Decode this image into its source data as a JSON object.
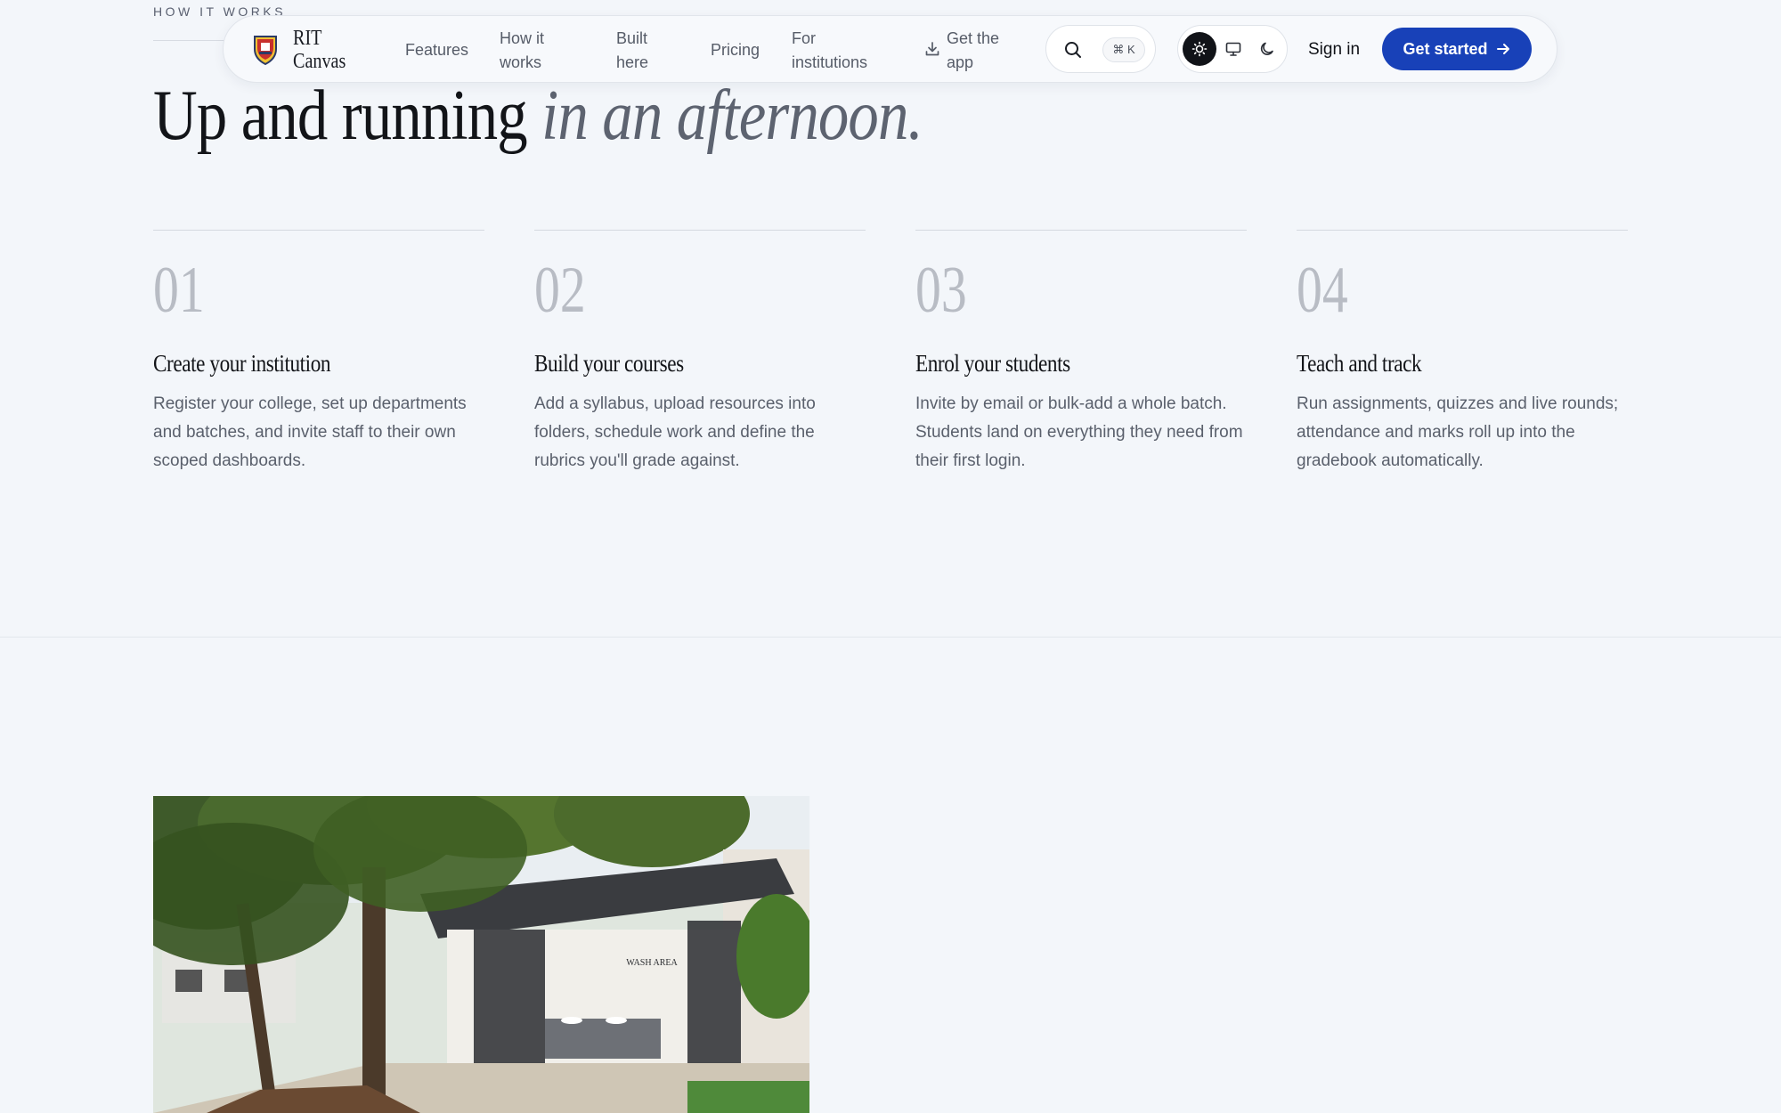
{
  "section": {
    "eyebrow": "HOW IT WORKS",
    "headline": "Up and running",
    "headline_italic": "in an afternoon."
  },
  "nav": {
    "brand": "RIT Canvas",
    "links": [
      {
        "label": "Features"
      },
      {
        "label": "How it works"
      },
      {
        "label": "Built here"
      },
      {
        "label": "Pricing"
      },
      {
        "label": "For institutions"
      },
      {
        "label": "Get the app",
        "icon": "download-icon"
      }
    ],
    "search_shortcut": "⌘ K",
    "theme_options": [
      "light",
      "system",
      "dark"
    ],
    "theme_selected": "light",
    "sign_in": "Sign in",
    "cta": "Get started",
    "accent_color": "#1841b8"
  },
  "steps": [
    {
      "number": "01",
      "title": "Create your institution",
      "text": "Register your college, set up departments and batches, and invite staff to their own scoped dashboards."
    },
    {
      "number": "02",
      "title": "Build your courses",
      "text": "Add a syllabus, upload resources into folders, schedule work and define the rubrics you'll grade against."
    },
    {
      "number": "03",
      "title": "Enrol your students",
      "text": "Invite by email or bulk-add a whole batch. Students land on everything they need from their first login."
    },
    {
      "number": "04",
      "title": "Teach and track",
      "text": "Run assignments, quizzes and live rounds; attendance and marks roll up into the gradebook automatically."
    }
  ],
  "photo": {
    "sign_text": "WASH AREA"
  }
}
